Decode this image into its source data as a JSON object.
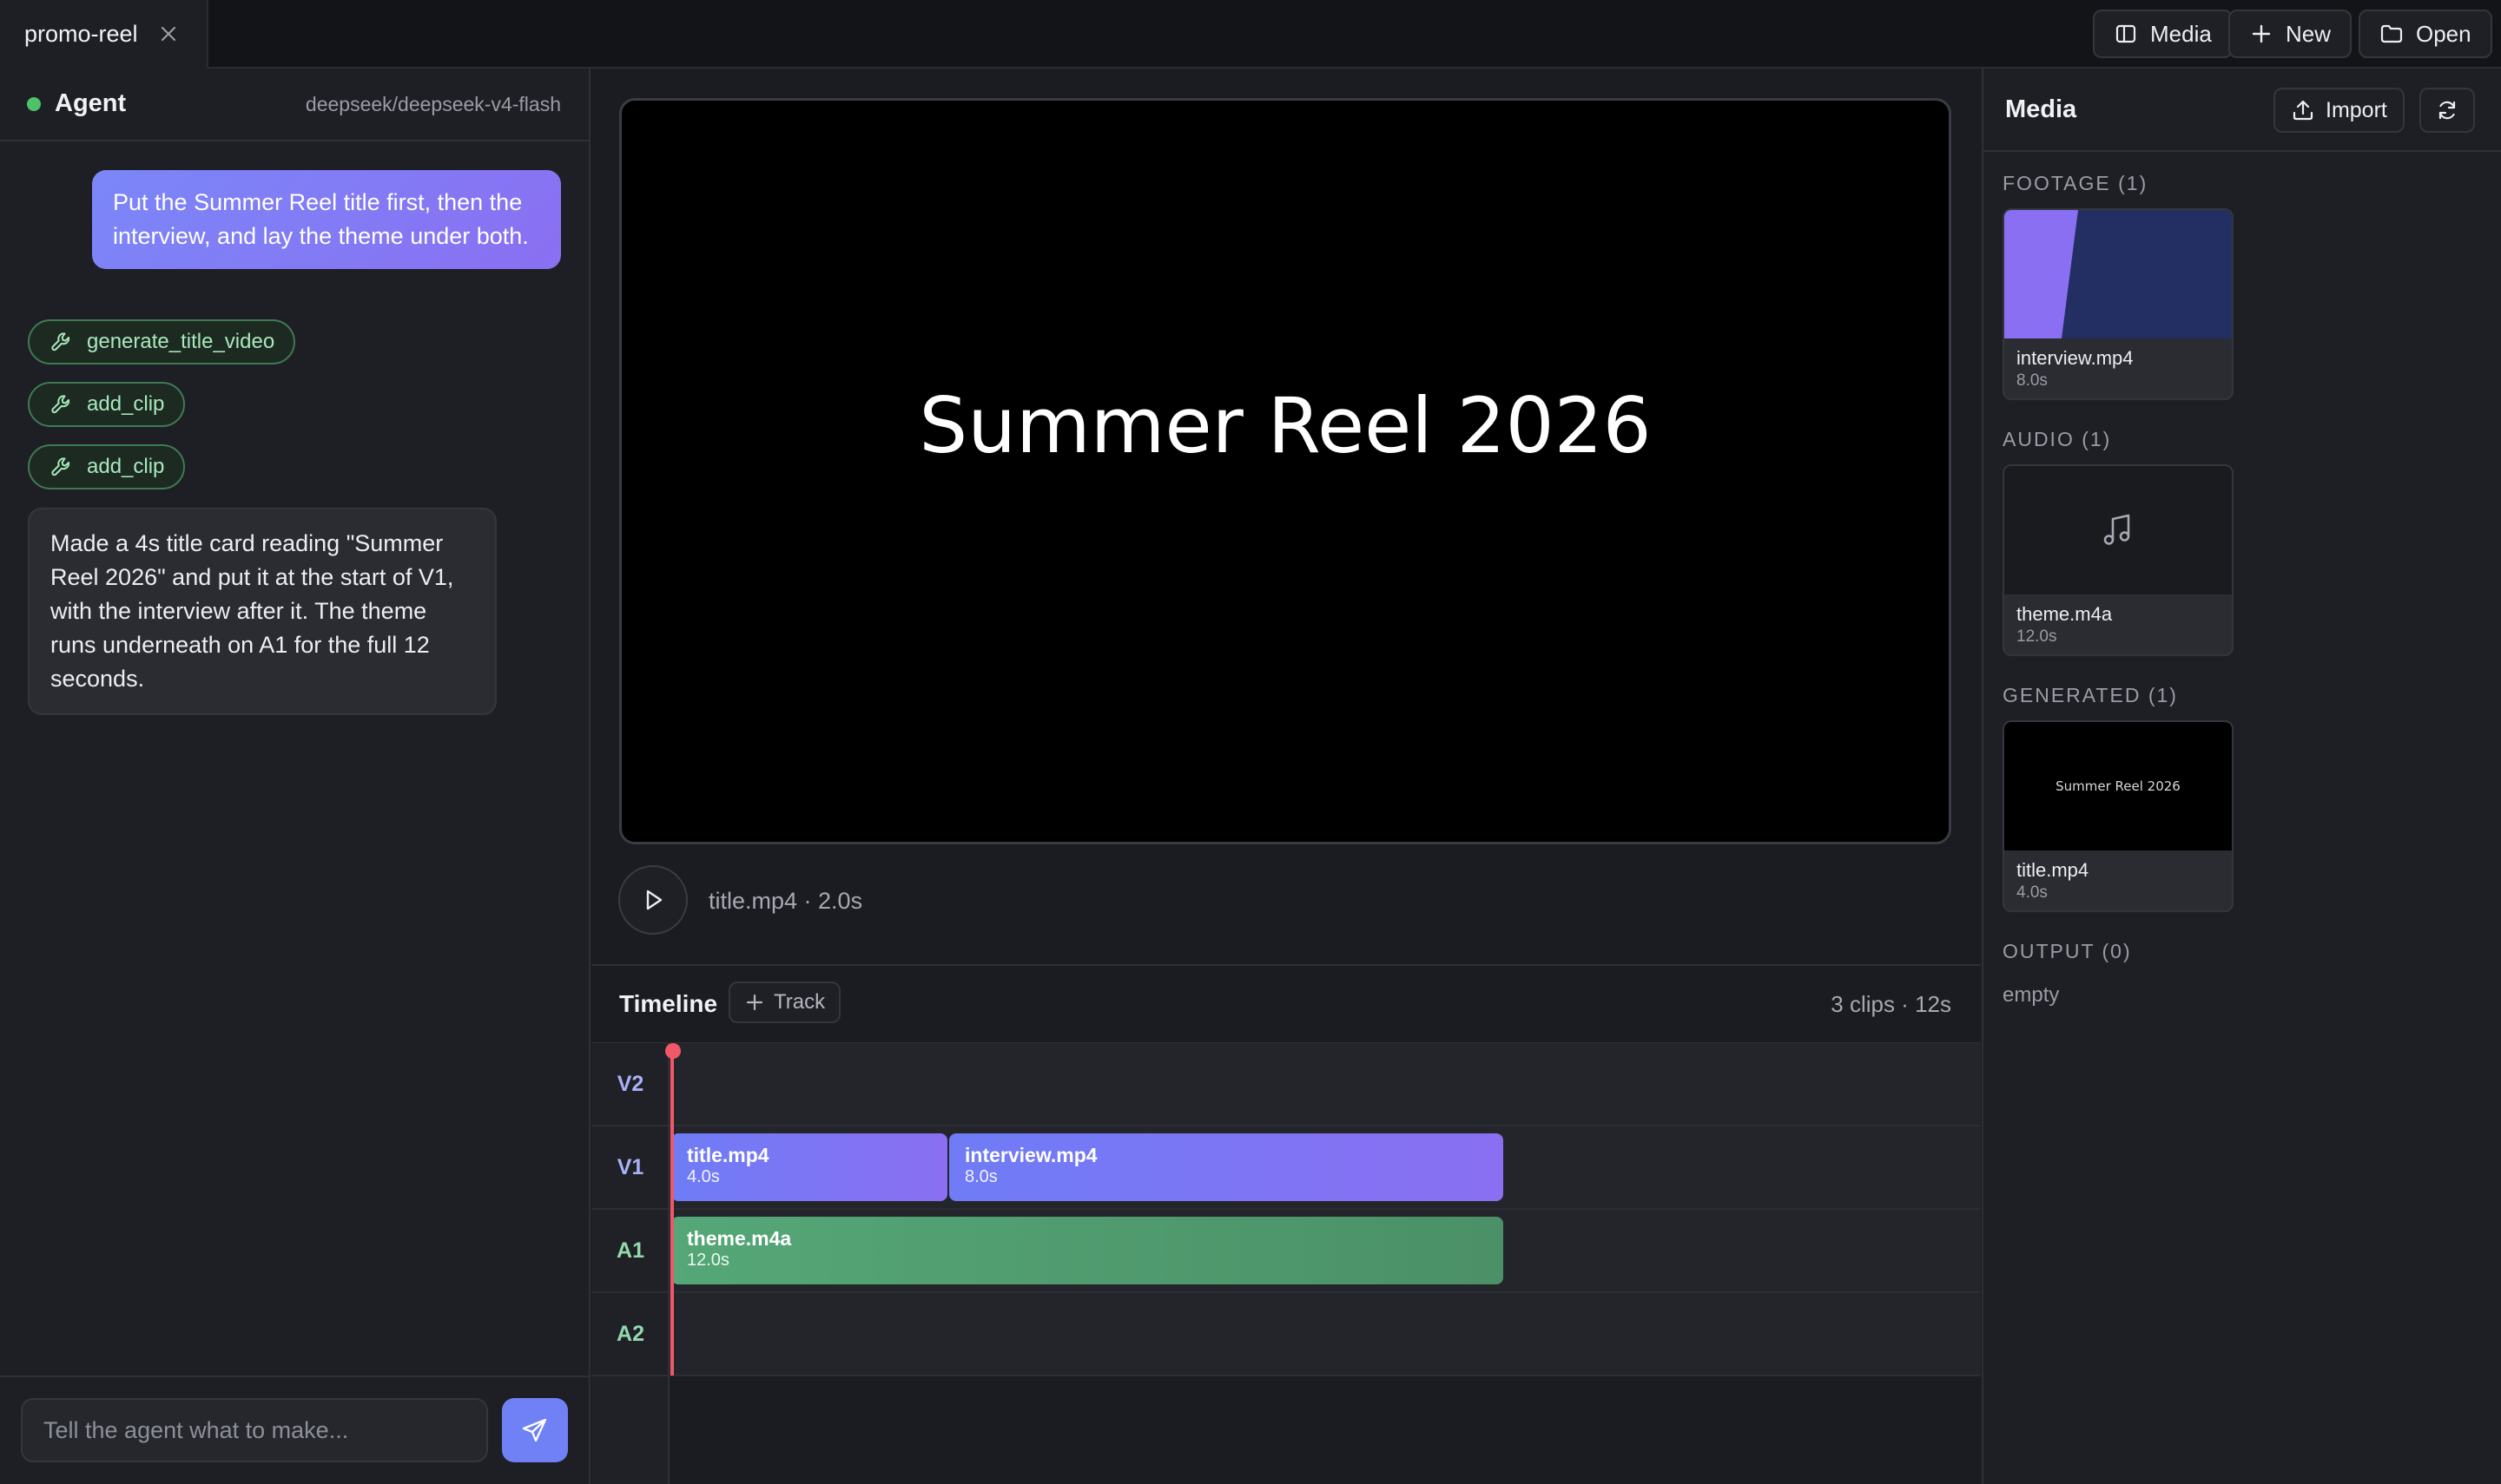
{
  "topbar": {
    "tab_name": "promo-reel",
    "buttons": {
      "media": "Media",
      "new": "New",
      "open": "Open"
    }
  },
  "agent": {
    "title": "Agent",
    "model": "deepseek/deepseek-v4-flash",
    "status_color": "#4ec26b",
    "user_message": "Put the Summer Reel title first, then the interview, and lay the theme under both.",
    "tool_calls": [
      "generate_title_video",
      "add_clip",
      "add_clip"
    ],
    "assistant_message": "Made a 4s title card reading \"Summer Reel 2026\" and put it at the start of V1, with the interview after it. The theme runs underneath on A1 for the full 12 seconds.",
    "composer_placeholder": "Tell the agent what to make..."
  },
  "preview": {
    "title_text": "Summer Reel 2026",
    "now_playing": "title.mp4 · 2.0s"
  },
  "timeline": {
    "title": "Timeline",
    "add_track_label": "Track",
    "summary": "3 clips · 12s",
    "lanes": [
      "V2",
      "V1",
      "A1",
      "A2"
    ],
    "clips": [
      {
        "name": "title.mp4",
        "duration": "4.0s"
      },
      {
        "name": "interview.mp4",
        "duration": "8.0s"
      },
      {
        "name": "theme.m4a",
        "duration": "12.0s"
      }
    ]
  },
  "media": {
    "title": "Media",
    "import_label": "Import",
    "sections": {
      "footage": "FOOTAGE (1)",
      "audio": "AUDIO (1)",
      "generated": "GENERATED (1)",
      "output": "OUTPUT (0)"
    },
    "items": {
      "footage": {
        "name": "interview.mp4",
        "duration": "8.0s"
      },
      "audio": {
        "name": "theme.m4a",
        "duration": "12.0s"
      },
      "generated": {
        "name": "title.mp4",
        "duration": "4.0s",
        "thumb_text": "Summer Reel 2026"
      }
    },
    "output_empty": "empty"
  },
  "colors": {
    "accent": "#7080f5",
    "video_clip": "#7b76f4",
    "audio_clip": "#52a070",
    "playhead": "#f05868",
    "video_lane_label": "#a9b2f8",
    "audio_lane_label": "#93d9ad"
  }
}
